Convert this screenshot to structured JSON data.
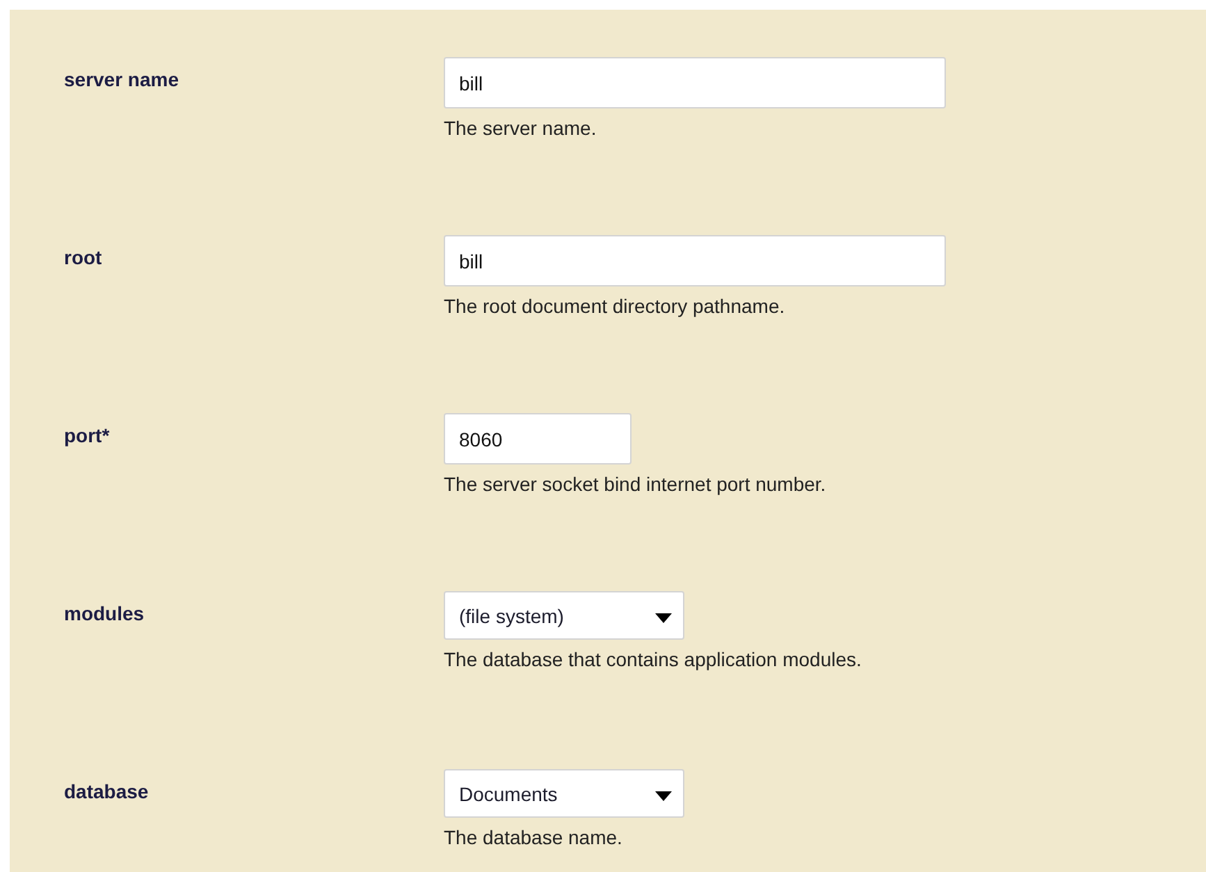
{
  "fields": [
    {
      "label": "server name",
      "kind": "text",
      "value": "bill",
      "help": "The server name."
    },
    {
      "label": "root",
      "kind": "text",
      "value": "bill",
      "help": "The root document directory pathname."
    },
    {
      "label": "port*",
      "kind": "number",
      "value": "8060",
      "help": "The server socket bind internet port number."
    },
    {
      "label": "modules",
      "kind": "select",
      "value": "(file system)",
      "help": "The database that contains application modules."
    },
    {
      "label": "database",
      "kind": "select",
      "value": "Documents",
      "help": "The database name."
    }
  ]
}
